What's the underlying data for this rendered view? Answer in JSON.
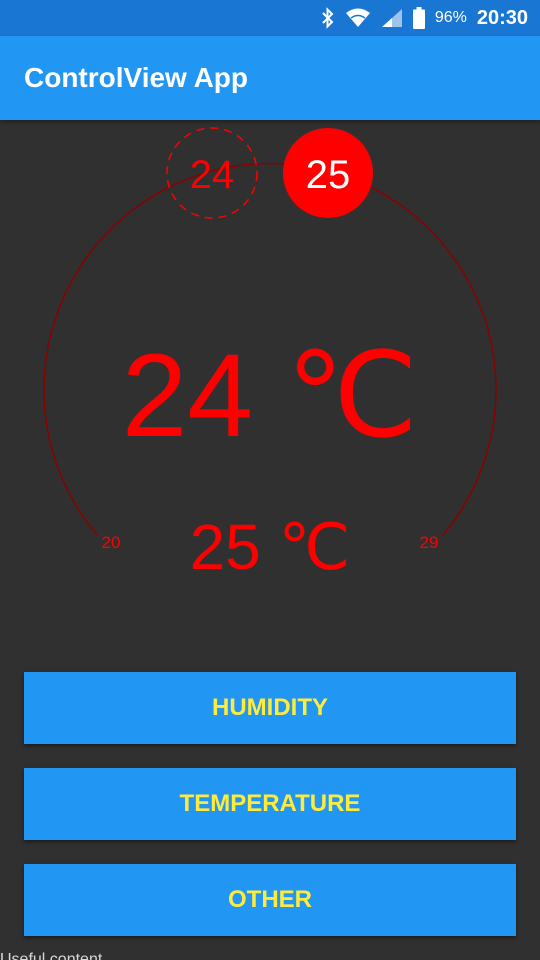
{
  "status_bar": {
    "battery_percent": "96%",
    "time": "20:30",
    "icons": [
      "bluetooth-icon",
      "wifi-icon",
      "signal-icon",
      "battery-icon"
    ]
  },
  "app_bar": {
    "title": "ControlView App"
  },
  "dial": {
    "current_temperature": "24 ℃",
    "target_temperature": "25 ℃",
    "current_marker": "24",
    "target_marker": "25",
    "min_label": "20",
    "max_label": "29"
  },
  "buttons": {
    "humidity": "HUMIDITY",
    "temperature": "TEMPERATURE",
    "other": "OTHER"
  },
  "footer": {
    "text": "Useful content"
  },
  "colors": {
    "status_bar": "#1976D2",
    "app_bar": "#2196F3",
    "background": "#303030",
    "accent_red": "#FF0000",
    "button_text": "#FFEB3B"
  }
}
